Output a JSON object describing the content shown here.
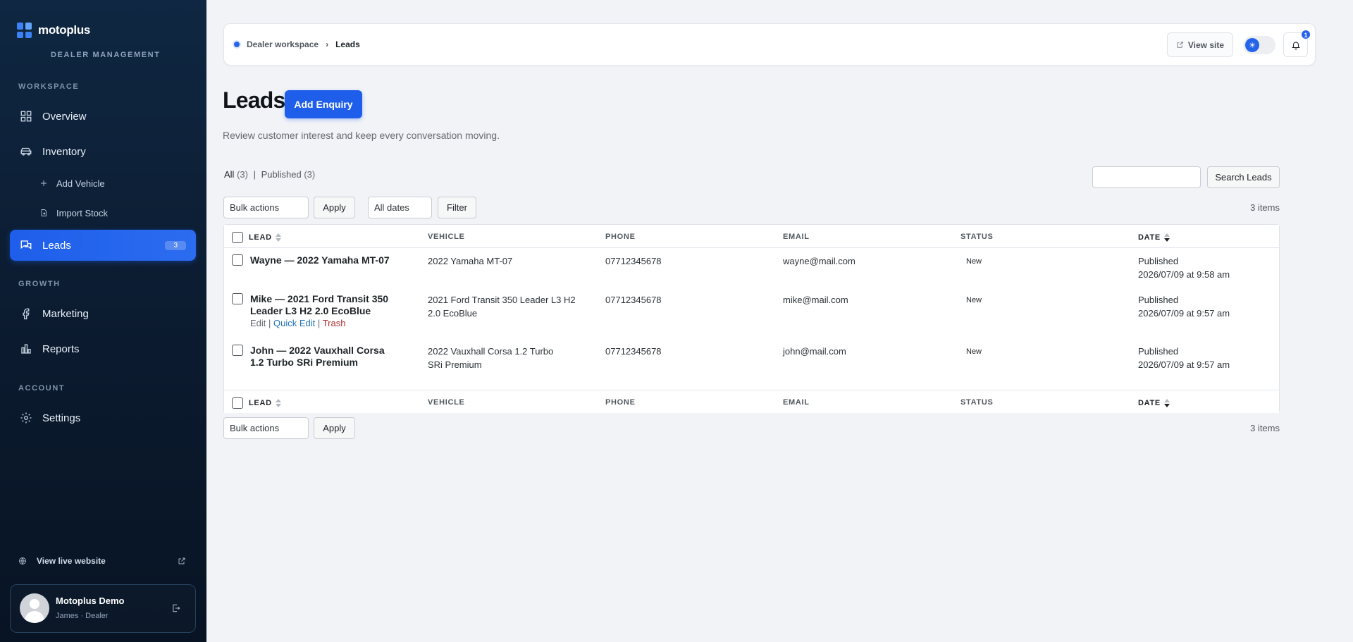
{
  "sidebar": {
    "brand": "motoplus",
    "brand_sub": "DEALER MANAGEMENT",
    "sections": {
      "workspace": "WORKSPACE",
      "growth": "GROWTH",
      "account": "ACCOUNT"
    },
    "items": {
      "overview": "Overview",
      "inventory": "Inventory",
      "add_vehicle": "Add Vehicle",
      "import_stock": "Import Stock",
      "leads": "Leads",
      "leads_badge": "3",
      "marketing": "Marketing",
      "reports": "Reports",
      "settings": "Settings"
    },
    "live_website": "View live website",
    "user": {
      "name": "Motoplus Demo",
      "role": "James · Dealer"
    }
  },
  "topbar": {
    "crumb_root": "Dealer workspace",
    "crumb_separator": "›",
    "crumb_current": "Leads",
    "view_site": "View site",
    "notifications_count": "1"
  },
  "page": {
    "title": "Leads",
    "add_button": "Add Enquiry",
    "description": "Review customer interest and keep every conversation moving."
  },
  "filters": {
    "all_label": "All",
    "all_count": "(3)",
    "separator": "|",
    "published_label": "Published",
    "published_count": "(3)",
    "search_button": "Search Leads",
    "bulk_actions": "Bulk actions",
    "apply": "Apply",
    "all_dates": "All dates",
    "filter": "Filter",
    "items_count": "3 items"
  },
  "table": {
    "columns": {
      "lead": "LEAD",
      "vehicle": "VEHICLE",
      "phone": "PHONE",
      "email": "EMAIL",
      "status": "STATUS",
      "date": "DATE"
    },
    "rows": [
      {
        "title": "Wayne — 2022 Yamaha MT-07",
        "vehicle": "2022 Yamaha MT-07",
        "phone": "07712345678",
        "email": "wayne@mail.com",
        "status": "New",
        "date_status": "Published",
        "date": "2026/07/09 at 9:58 am"
      },
      {
        "title": "Mike — 2021 Ford Transit 350 Leader L3 H2 2.0 EcoBlue",
        "vehicle": "2021 Ford Transit 350 Leader L3 H2 2.0 EcoBlue",
        "phone": "07712345678",
        "email": "mike@mail.com",
        "status": "New",
        "date_status": "Published",
        "date": "2026/07/09 at 9:57 am"
      },
      {
        "title": "John — 2022 Vauxhall Corsa 1.2 Turbo SRi Premium",
        "vehicle": "2022 Vauxhall Corsa 1.2 Turbo SRi Premium",
        "phone": "07712345678",
        "email": "john@mail.com",
        "status": "New",
        "date_status": "Published",
        "date": "2026/07/09 at 9:57 am"
      }
    ],
    "row_actions": {
      "edit": "Edit",
      "quick_edit": "Quick Edit",
      "trash": "Trash",
      "separator": "|"
    }
  },
  "colors": {
    "accent": "#1e5eea",
    "sidebar_bg": "#0b1a2e",
    "trash": "#b32d2e",
    "link": "#2271b1"
  }
}
